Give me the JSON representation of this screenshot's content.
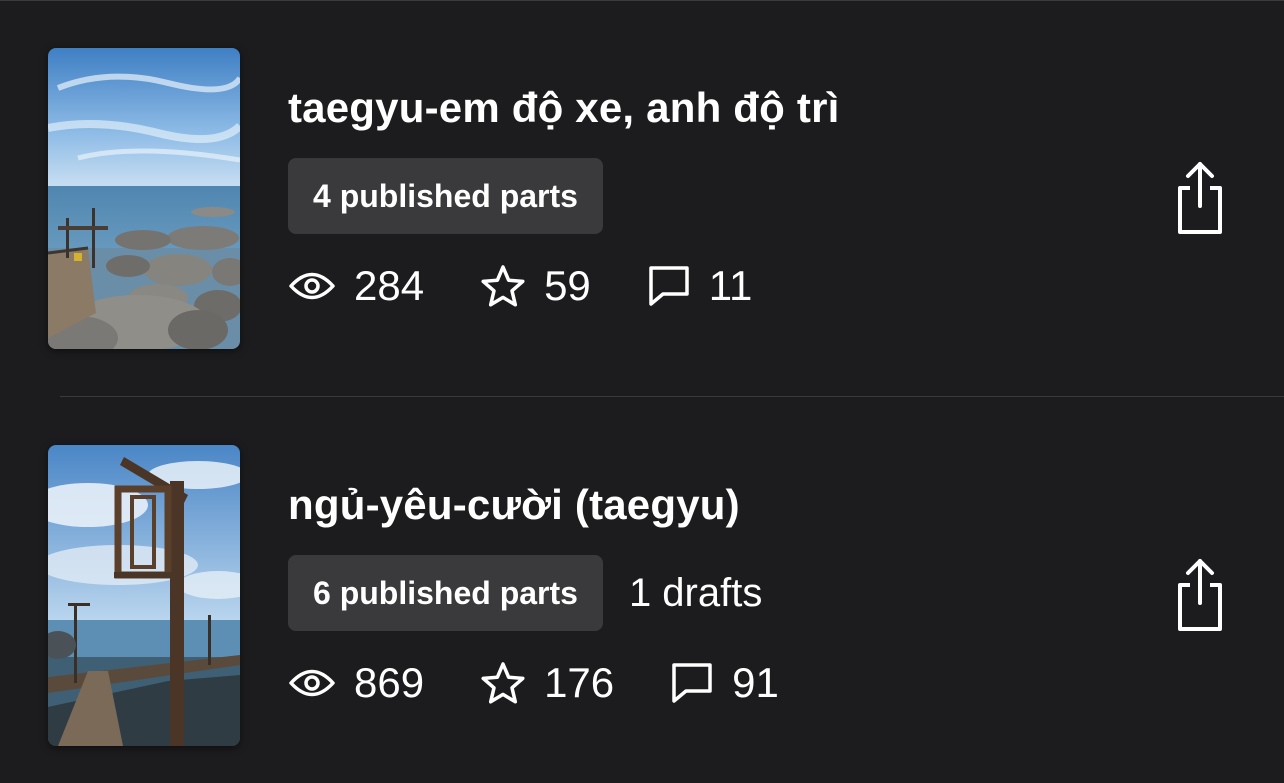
{
  "stories": [
    {
      "title": "taegyu-em độ xe, anh độ trì",
      "published_parts": "4 published parts",
      "drafts": "",
      "views": "284",
      "votes": "59",
      "comments": "11",
      "cover_icon": "seaside-rocks-photo"
    },
    {
      "title": "ngủ-yêu-cười (taegyu)",
      "published_parts": "6 published parts",
      "drafts": "1 drafts",
      "views": "869",
      "votes": "176",
      "comments": "91",
      "cover_icon": "seaside-lamp-photo"
    }
  ],
  "icons": {
    "views": "eye-icon",
    "votes": "star-icon",
    "comments": "comment-icon",
    "share": "share-icon"
  },
  "colors": {
    "background": "#1c1c1e",
    "badge": "#3a3a3c",
    "text": "#ffffff"
  }
}
